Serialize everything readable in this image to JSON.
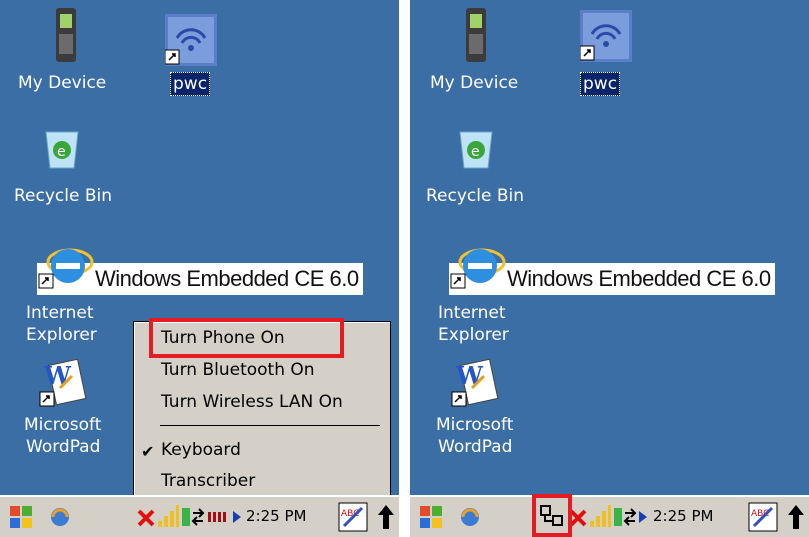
{
  "left_screen": {
    "desktop_icons": [
      {
        "label": "My Device",
        "icon": "device-icon"
      },
      {
        "label": "pwc",
        "icon": "wifi-icon"
      },
      {
        "label": "Recycle Bin",
        "icon": "recycle-bin-icon"
      },
      {
        "label": "Internet",
        "label2": "Explorer",
        "icon": "ie-icon"
      },
      {
        "label": "Microsoft",
        "label2": "WordPad",
        "icon": "wordpad-icon"
      }
    ],
    "banner_text": "Windows Embedded CE 6.0",
    "menu": {
      "items": [
        "Turn Phone On",
        "Turn Bluetooth On",
        "Turn Wireless LAN On",
        "Keyboard",
        "Transcriber"
      ],
      "checked_item": "Keyboard"
    },
    "taskbar": {
      "clock": "2:25 PM"
    }
  },
  "right_screen": {
    "desktop_icons": [
      {
        "label": "My Device",
        "icon": "device-icon"
      },
      {
        "label": "pwc",
        "icon": "wifi-icon"
      },
      {
        "label": "Recycle Bin",
        "icon": "recycle-bin-icon"
      },
      {
        "label": "Internet",
        "label2": "Explorer",
        "icon": "ie-icon"
      },
      {
        "label": "Microsoft",
        "label2": "WordPad",
        "icon": "wordpad-icon"
      }
    ],
    "banner_text": "Windows Embedded CE 6.0",
    "taskbar": {
      "clock": "2:25 PM"
    }
  },
  "colors": {
    "desktop": "#3a6ea5",
    "highlight": "#e51c23",
    "taskbar": "#d4d0c8"
  }
}
